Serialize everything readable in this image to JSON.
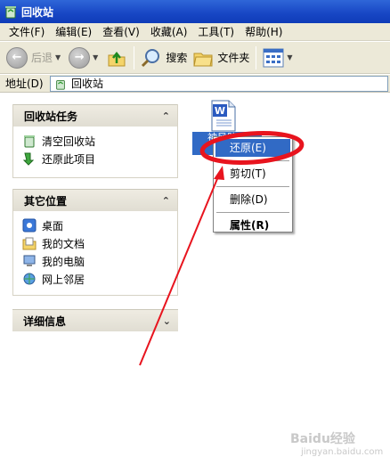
{
  "window": {
    "title": "回收站"
  },
  "menubar": {
    "items": [
      "文件(F)",
      "编辑(E)",
      "查看(V)",
      "收藏(A)",
      "工具(T)",
      "帮助(H)"
    ]
  },
  "toolbar": {
    "back": "后退",
    "search": "搜索",
    "folders": "文件夹"
  },
  "address": {
    "label": "地址(D)",
    "value": "回收站"
  },
  "tasks_panel": {
    "title": "回收站任务",
    "items": [
      "清空回收站",
      "还原此项目"
    ]
  },
  "places_panel": {
    "title": "其它位置",
    "items": [
      "桌面",
      "我的文档",
      "我的电脑",
      "网上邻居"
    ]
  },
  "details_panel": {
    "title": "详细信息"
  },
  "file": {
    "name_line1": "神风队去",
    "name_line2": "目"
  },
  "context_menu": {
    "items": [
      "还原(E)",
      "剪切(T)",
      "删除(D)",
      "属性(R)"
    ]
  },
  "annotation": {
    "color": "#e8141e"
  },
  "watermark": {
    "text": "Baidu经验",
    "sub": "jingyan.baidu.com"
  },
  "colors": {
    "titlebar": "#1746c4",
    "selection": "#316ac5",
    "chrome": "#ece9d8"
  }
}
